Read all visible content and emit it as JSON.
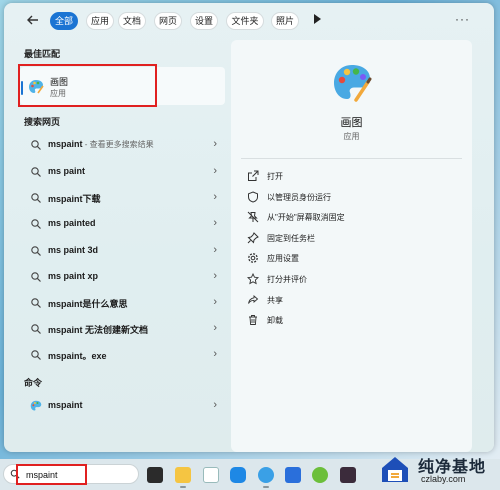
{
  "tabs": [
    {
      "label": "全部",
      "active": true
    },
    {
      "label": "应用"
    },
    {
      "label": "文档"
    },
    {
      "label": "网页"
    },
    {
      "label": "设置"
    },
    {
      "label": "文件夹"
    },
    {
      "label": "照片"
    }
  ],
  "more_label": "···",
  "best_match": {
    "heading": "最佳匹配",
    "title": "画图",
    "subtitle": "应用"
  },
  "web_search": {
    "heading": "搜索网页",
    "items": [
      {
        "label": "mspaint",
        "sub": " - 查看更多搜索结果"
      },
      {
        "label": "ms paint"
      },
      {
        "label": "mspaint下载"
      },
      {
        "label": "ms painted"
      },
      {
        "label": "ms paint 3d"
      },
      {
        "label": "ms paint xp"
      },
      {
        "label": "mspaint是什么意思"
      },
      {
        "label": "mspaint 无法创建新文档"
      },
      {
        "label": "mspaint。exe"
      }
    ]
  },
  "commands": {
    "heading": "命令",
    "items": [
      {
        "label": "mspaint"
      }
    ]
  },
  "detail": {
    "title": "画图",
    "subtitle": "应用",
    "actions": [
      {
        "label": "打开",
        "icon": "open-icon"
      },
      {
        "label": "以管理员身份运行",
        "icon": "shield-icon"
      },
      {
        "label": "从\"开始\"屏幕取消固定",
        "icon": "unpin-icon"
      },
      {
        "label": "固定到任务栏",
        "icon": "pin-icon"
      },
      {
        "label": "应用设置",
        "icon": "gear-icon"
      },
      {
        "label": "打分并评价",
        "icon": "star-icon"
      },
      {
        "label": "共享",
        "icon": "share-icon"
      },
      {
        "label": "卸载",
        "icon": "trash-icon"
      }
    ]
  },
  "taskbar": {
    "search_value": "mspaint"
  },
  "watermark": {
    "title": "纯净基地",
    "subtitle": "czlaby.com"
  },
  "colors": {
    "accent": "#1b74d3",
    "highlight": "#e02020"
  }
}
